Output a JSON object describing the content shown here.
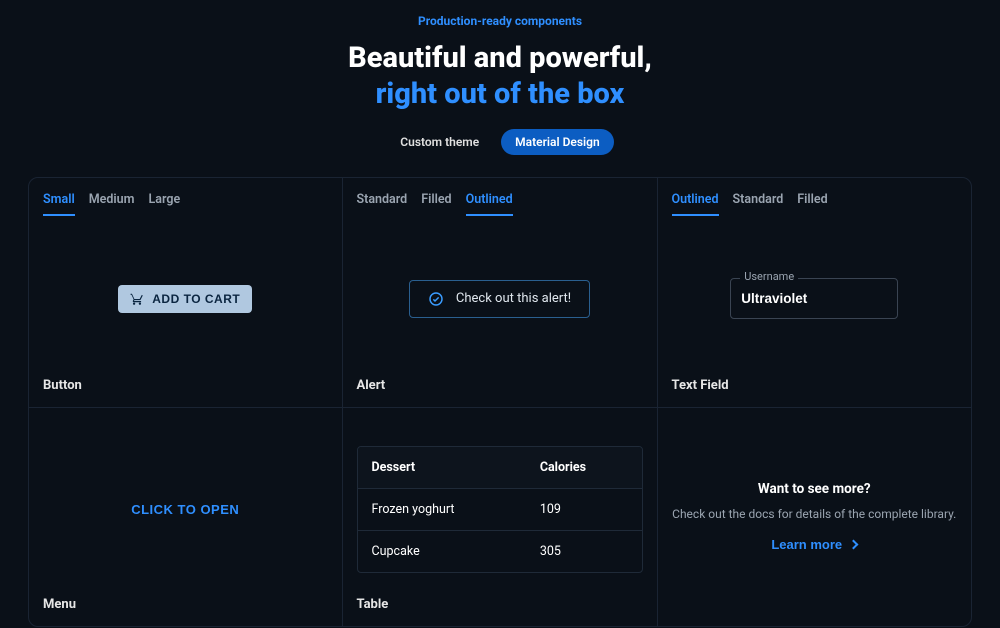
{
  "header": {
    "overline": "Production-ready components",
    "title_line1": "Beautiful and powerful,",
    "title_line2": "right out of the box",
    "chips": {
      "custom": "Custom theme",
      "material": "Material Design"
    }
  },
  "card_button": {
    "tabs": {
      "small": "Small",
      "medium": "Medium",
      "large": "Large"
    },
    "cta": "ADD TO CART",
    "label": "Button"
  },
  "card_alert": {
    "tabs": {
      "standard": "Standard",
      "filled": "Filled",
      "outlined": "Outlined"
    },
    "text": "Check out this alert!",
    "label": "Alert"
  },
  "card_textfield": {
    "tabs": {
      "outlined": "Outlined",
      "standard": "Standard",
      "filled": "Filled"
    },
    "field_label": "Username",
    "value": "Ultraviolet",
    "label": "Text Field"
  },
  "card_menu": {
    "cta": "CLICK TO OPEN",
    "label": "Menu"
  },
  "card_table": {
    "columns": {
      "dessert": "Dessert",
      "calories": "Calories"
    },
    "rows": [
      {
        "dessert": "Frozen yoghurt",
        "calories": "109"
      },
      {
        "dessert": "Cupcake",
        "calories": "305"
      }
    ],
    "label": "Table"
  },
  "card_more": {
    "title": "Want to see more?",
    "sub": "Check out the docs for details of the complete library.",
    "cta": "Learn more"
  }
}
